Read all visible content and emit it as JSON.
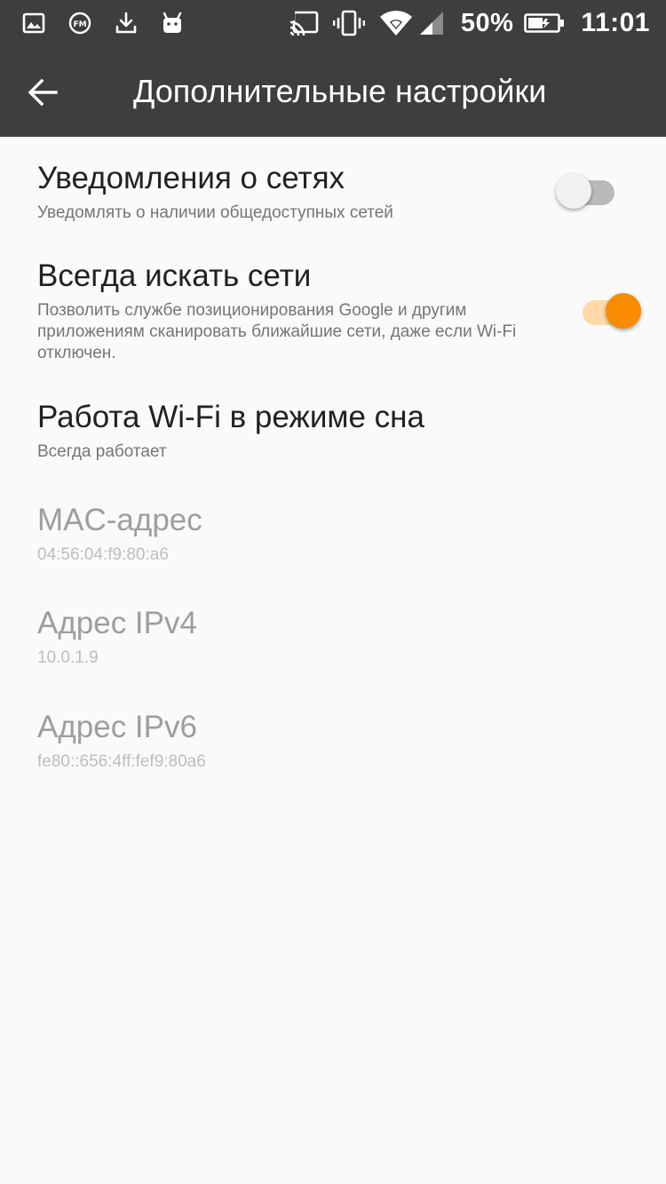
{
  "status_bar": {
    "icons_left": [
      "image-icon",
      "fm-radio-icon",
      "download-icon",
      "android-icon"
    ],
    "icons_right": [
      "cast-icon",
      "vibrate-icon",
      "wifi-icon",
      "cell-signal-icon"
    ],
    "battery_percent": "50%",
    "time": "11:01"
  },
  "app_bar": {
    "title": "Дополнительные настройки",
    "back_icon": "arrow-back-icon"
  },
  "colors": {
    "bar": "#3e3e3e",
    "accent": "#f98c00",
    "accent_track": "#ffd9a8",
    "text_primary": "#212121",
    "text_secondary": "#757575",
    "text_disabled": "#9e9e9e"
  },
  "prefs": [
    {
      "title": "Уведомления о сетях",
      "summary": "Уведомлять о наличии общедоступных сетей",
      "switch_on": false
    },
    {
      "title": "Всегда искать сети",
      "summary": "Позволить службе позиционирования Google и другим приложениям сканировать ближайшие сети, даже если Wi-Fi отключен.",
      "switch_on": true
    },
    {
      "title": "Работа Wi-Fi в режиме сна",
      "summary": "Всегда работает"
    },
    {
      "title": "MAC-адрес",
      "summary": "04:56:04:f9:80:a6"
    },
    {
      "title": "Адрес IPv4",
      "summary": "10.0.1.9"
    },
    {
      "title": "Адрес IPv6",
      "summary": "fe80::656:4ff:fef9:80a6"
    }
  ]
}
